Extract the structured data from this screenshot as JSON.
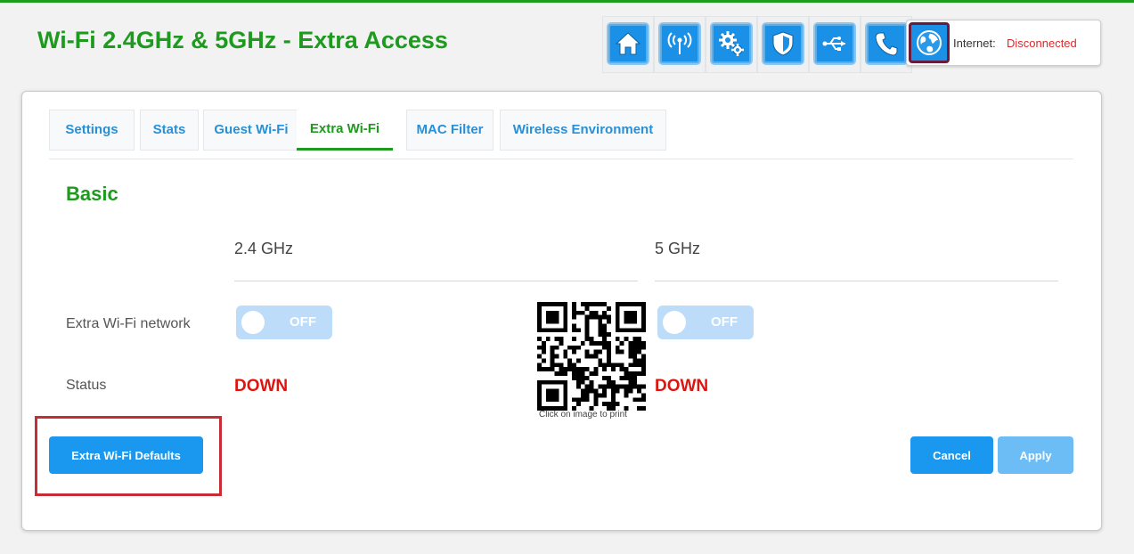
{
  "header": {
    "title": "Wi-Fi 2.4GHz & 5GHz - Extra Access",
    "nav_icons": [
      "home-icon",
      "wireless-icon",
      "gears-icon",
      "shield-icon",
      "usb-icon",
      "phone-icon"
    ],
    "internet_icon": "globe-icon",
    "internet_label": "Internet:",
    "internet_status": "Disconnected"
  },
  "tabs": [
    {
      "label": "Settings"
    },
    {
      "label": "Stats"
    },
    {
      "label": "Guest Wi-Fi"
    },
    {
      "label": "Extra Wi-Fi"
    },
    {
      "label": "MAC Filter"
    },
    {
      "label": "Wireless Environment"
    }
  ],
  "active_tab": "Extra Wi-Fi",
  "section": {
    "title": "Basic"
  },
  "columns": {
    "band1": "2.4 GHz",
    "band2": "5 GHz"
  },
  "rows": {
    "network_label": "Extra Wi-Fi network",
    "status_label": "Status"
  },
  "toggles": {
    "band1": "OFF",
    "band2": "OFF"
  },
  "status": {
    "band1": "DOWN",
    "band2": "DOWN"
  },
  "qr": {
    "caption": "Click on image to print"
  },
  "buttons": {
    "defaults": "Extra Wi-Fi Defaults",
    "cancel": "Cancel",
    "apply": "Apply"
  },
  "colors": {
    "brand_green": "#1e9a1e",
    "accent_blue": "#1a98ef",
    "alert_red": "#e0140f",
    "highlight_red": "#c62d36"
  }
}
